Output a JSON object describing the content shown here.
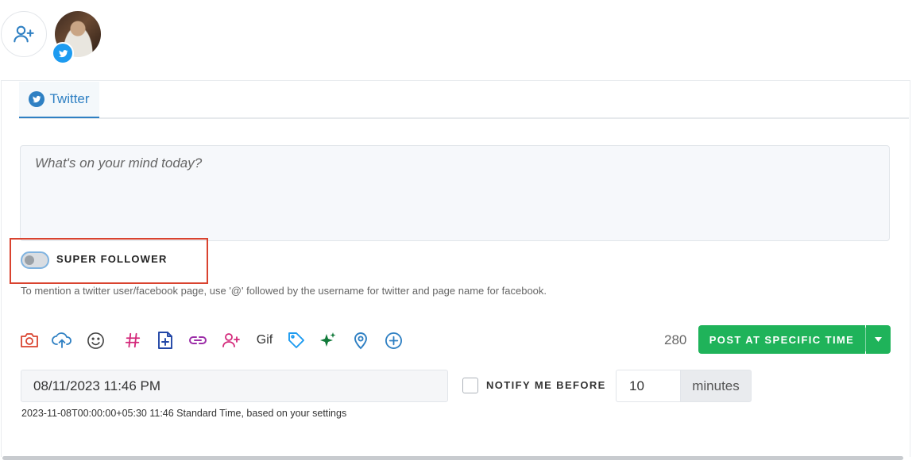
{
  "accounts": {
    "add_account": "add-user-icon",
    "avatar_network": "twitter-icon"
  },
  "tabs": [
    {
      "label": "Twitter",
      "icon": "twitter-icon",
      "active": true
    }
  ],
  "composer": {
    "placeholder": "What's on your mind today?",
    "value": ""
  },
  "super_follower": {
    "label": "SUPER FOLLOWER",
    "enabled": false
  },
  "hint": "To mention a twitter user/facebook page, use '@' followed by the username for twitter and page name for facebook.",
  "toolbar": {
    "icons": [
      "camera-icon",
      "upload-icon",
      "emoji-icon",
      "hashtag-icon",
      "add-document-icon",
      "link-icon",
      "add-user-icon",
      "gif-label",
      "tag-icon",
      "sparkle-icon",
      "location-pin-icon",
      "plus-circle-icon"
    ],
    "gif_label": "Gif",
    "char_count": "280",
    "post_label": "POST AT SPECIFIC TIME"
  },
  "schedule": {
    "datetime_value": "08/11/2023 11:46 PM",
    "notify_label": "NOTIFY ME BEFORE",
    "notify_checked": false,
    "minutes_value": "10",
    "minutes_unit": "minutes",
    "timezone_note": "2023-11-08T00:00:00+05:30 11:46 Standard Time, based on your settings"
  },
  "colors": {
    "accent": "#2f80c3",
    "twitter": "#1d9bf0",
    "post_button": "#1fb35a",
    "highlight": "#d9432f"
  }
}
